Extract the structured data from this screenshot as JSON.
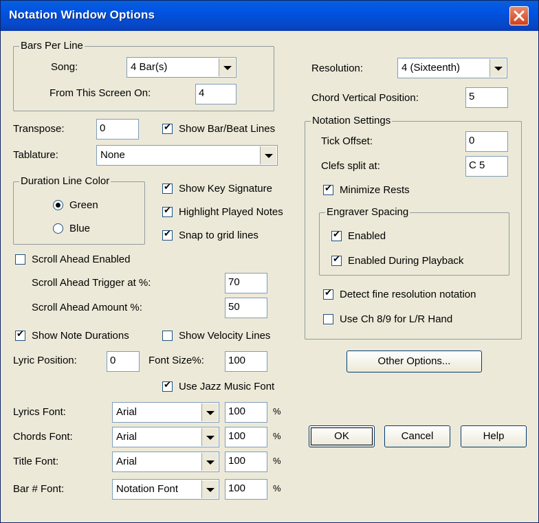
{
  "window": {
    "title": "Notation Window Options"
  },
  "bars_per_line": {
    "group_title": "Bars Per Line",
    "song_label": "Song:",
    "song_value": "4 Bar(s)",
    "from_screen_label": "From This Screen On:",
    "from_screen_value": "4"
  },
  "resolution": {
    "label": "Resolution:",
    "value": "4 (Sixteenth)"
  },
  "chord_vertical": {
    "label": "Chord Vertical Position:",
    "value": "5"
  },
  "transpose": {
    "label": "Transpose:",
    "value": "0"
  },
  "show_bar_beat": {
    "label": "Show Bar/Beat Lines",
    "checked": true
  },
  "tablature": {
    "label": "Tablature:",
    "value": "None"
  },
  "duration_color": {
    "group_title": "Duration Line Color",
    "green_label": "Green",
    "blue_label": "Blue",
    "selected": "Green"
  },
  "options": {
    "show_key_signature": {
      "label": "Show Key Signature",
      "checked": true
    },
    "highlight_played": {
      "label": "Highlight Played Notes",
      "checked": true
    },
    "snap_to_grid": {
      "label": "Snap to grid lines",
      "checked": true
    }
  },
  "scroll_ahead": {
    "enabled_label": "Scroll Ahead Enabled",
    "enabled": false,
    "trigger_label": "Scroll Ahead Trigger at %:",
    "trigger_value": "70",
    "amount_label": "Scroll Ahead Amount %:",
    "amount_value": "50"
  },
  "show_note_durations": {
    "label": "Show Note Durations",
    "checked": true
  },
  "show_velocity_lines": {
    "label": "Show Velocity Lines",
    "checked": false
  },
  "lyric": {
    "position_label": "Lyric Position:",
    "position_value": "0",
    "font_size_label": "Font Size%:",
    "font_size_value": "100"
  },
  "use_jazz_font": {
    "label": "Use Jazz Music Font",
    "checked": true
  },
  "fonts": {
    "lyrics": {
      "label": "Lyrics Font:",
      "value": "Arial",
      "size": "100",
      "unit": "%"
    },
    "chords": {
      "label": "Chords Font:",
      "value": "Arial",
      "size": "100",
      "unit": "%"
    },
    "title": {
      "label": "Title Font:",
      "value": "Arial",
      "size": "100",
      "unit": "%"
    },
    "bar_num": {
      "label": "Bar # Font:",
      "value": "Notation Font",
      "size": "100",
      "unit": "%"
    }
  },
  "notation_settings": {
    "group_title": "Notation Settings",
    "tick_offset_label": "Tick Offset:",
    "tick_offset_value": "0",
    "clefs_split_label": "Clefs split at:",
    "clefs_split_value": "C 5",
    "minimize_rests": {
      "label": "Minimize Rests",
      "checked": true
    },
    "engraver": {
      "group_title": "Engraver Spacing",
      "enabled": {
        "label": "Enabled",
        "checked": true
      },
      "during_playback": {
        "label": "Enabled During Playback",
        "checked": true
      }
    },
    "detect_fine": {
      "label": "Detect fine resolution notation",
      "checked": true
    },
    "use_ch89": {
      "label": "Use Ch 8/9 for L/R Hand",
      "checked": false
    }
  },
  "buttons": {
    "other_options": "Other Options...",
    "ok": "OK",
    "cancel": "Cancel",
    "help": "Help"
  },
  "colors": {
    "title_bar": "#0055e5",
    "dialog_bg": "#ece9d8",
    "close_button": "#d0401c"
  },
  "icons": {
    "close": "close-icon",
    "dropdown": "chevron-down-icon",
    "check": "check-icon"
  }
}
